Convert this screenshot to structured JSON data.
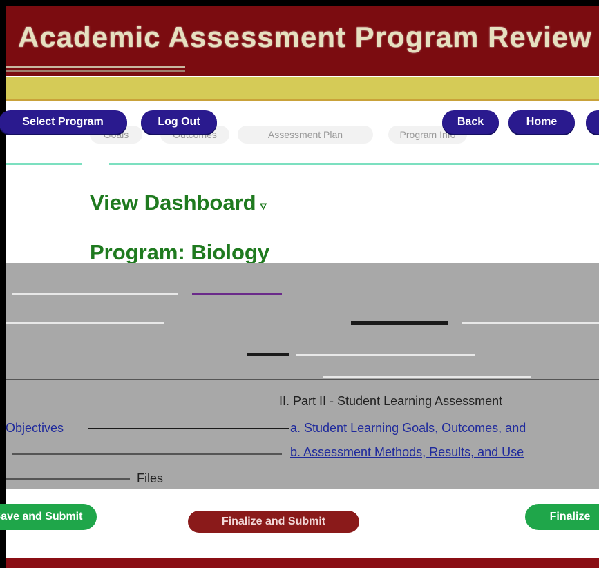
{
  "banner": {
    "title": "Academic Assessment Program Review"
  },
  "nav": {
    "select_program": "Select Program",
    "log_out": "Log Out",
    "back": "Back",
    "home": "Home"
  },
  "ghost_nav": [
    "Goals",
    "Outcomes",
    "Assessment Plan",
    "Program Info"
  ],
  "page": {
    "view_dashboard": "View Dashboard",
    "dashboard_caret": "▿",
    "program": "Program: Biology"
  },
  "outline": {
    "part2": "II. Part II - Student Learning Assessment",
    "objectives": "Objectives",
    "item_a": "a. Student Learning Goals, Outcomes, and",
    "item_b": "b. Assessment Methods, Results, and Use",
    "files": "Files"
  },
  "actions": {
    "save_and_submit": "Save and Submit",
    "finalize_and_submit": "Finalize and Submit",
    "finalize": "Finalize"
  }
}
